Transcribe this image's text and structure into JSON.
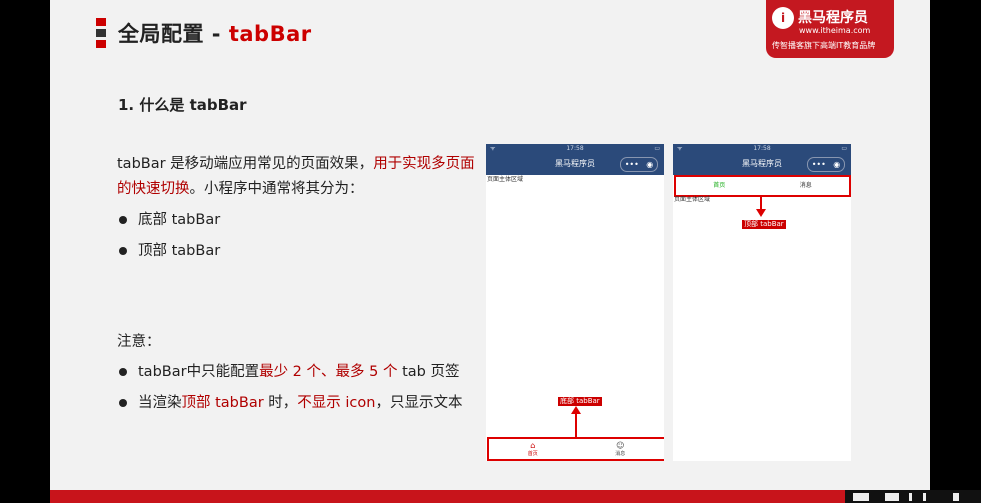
{
  "header": {
    "title_prefix": "全局配置 - ",
    "title_highlight": "tabBar"
  },
  "logo": {
    "badge": "i",
    "name": "黑马程序员",
    "url": "www.itheima.com",
    "slogan": "传智播客旗下高端IT教育品牌"
  },
  "section": {
    "heading": "1. 什么是 tabBar"
  },
  "intro": {
    "part1": "tabBar 是移动端应用常见的页面效果，",
    "part2_highlight": "用于实现多页面的快速切换",
    "part3": "。小程序中通常将其分为："
  },
  "types": [
    {
      "label": "底部 tabBar"
    },
    {
      "label": "顶部 tabBar"
    }
  ],
  "notes": {
    "title": "注意：",
    "n1_a": "tabBar中只能配置",
    "n1_b": "最少 2 个、最多 5 个",
    "n1_c": " tab 页签",
    "n2_a": "当渲染",
    "n2_b": "顶部 tabBar",
    "n2_c": " 时，",
    "n2_d": "不显示 icon",
    "n2_e": "，只显示文本"
  },
  "phone_bottom": {
    "time": "17:58",
    "signal": "ᯤ",
    "battery": "▭",
    "nav_title": "黑马程序员",
    "capsule_dots": "•••",
    "capsule_target": "◉",
    "page_text": "页面主体区域",
    "annotation": "底部 tabBar",
    "tabs": [
      {
        "label": "首页",
        "icon": "⌂"
      },
      {
        "label": "消息",
        "icon": "☺"
      }
    ]
  },
  "phone_top": {
    "time": "17:58",
    "signal": "ᯤ",
    "battery": "▭",
    "nav_title": "黑马程序员",
    "capsule_dots": "•••",
    "capsule_target": "◉",
    "page_text": "页面主体区域",
    "annotation": "顶部 tabBar",
    "tabs": [
      {
        "label": "首页"
      },
      {
        "label": "消息"
      }
    ]
  },
  "colors": {
    "accent": "#c00000",
    "navbar": "#2b4a7a",
    "active_tab_green": "#1aad19"
  }
}
